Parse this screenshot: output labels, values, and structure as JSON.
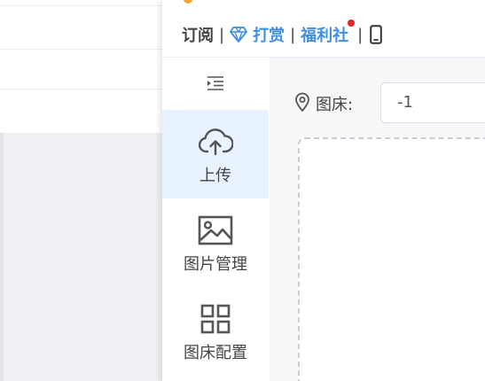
{
  "topnav": {
    "subscribe": "订阅",
    "sep1": "|",
    "reward": "打赏",
    "sep2": "|",
    "welfare": "福利社",
    "sep3": "|"
  },
  "sidebar": {
    "items": [
      {
        "label": "上传",
        "icon": "cloud-upload-icon",
        "active": true
      },
      {
        "label": "图片管理",
        "icon": "image-icon",
        "active": false
      },
      {
        "label": "图床配置",
        "icon": "grid-icon",
        "active": false
      }
    ]
  },
  "main": {
    "picbed_label": "图床:",
    "picbed_value": "-1"
  },
  "colors": {
    "accent": "#3f8fe0",
    "active_bg": "#e9f3ff",
    "badge": "#e5252a"
  }
}
